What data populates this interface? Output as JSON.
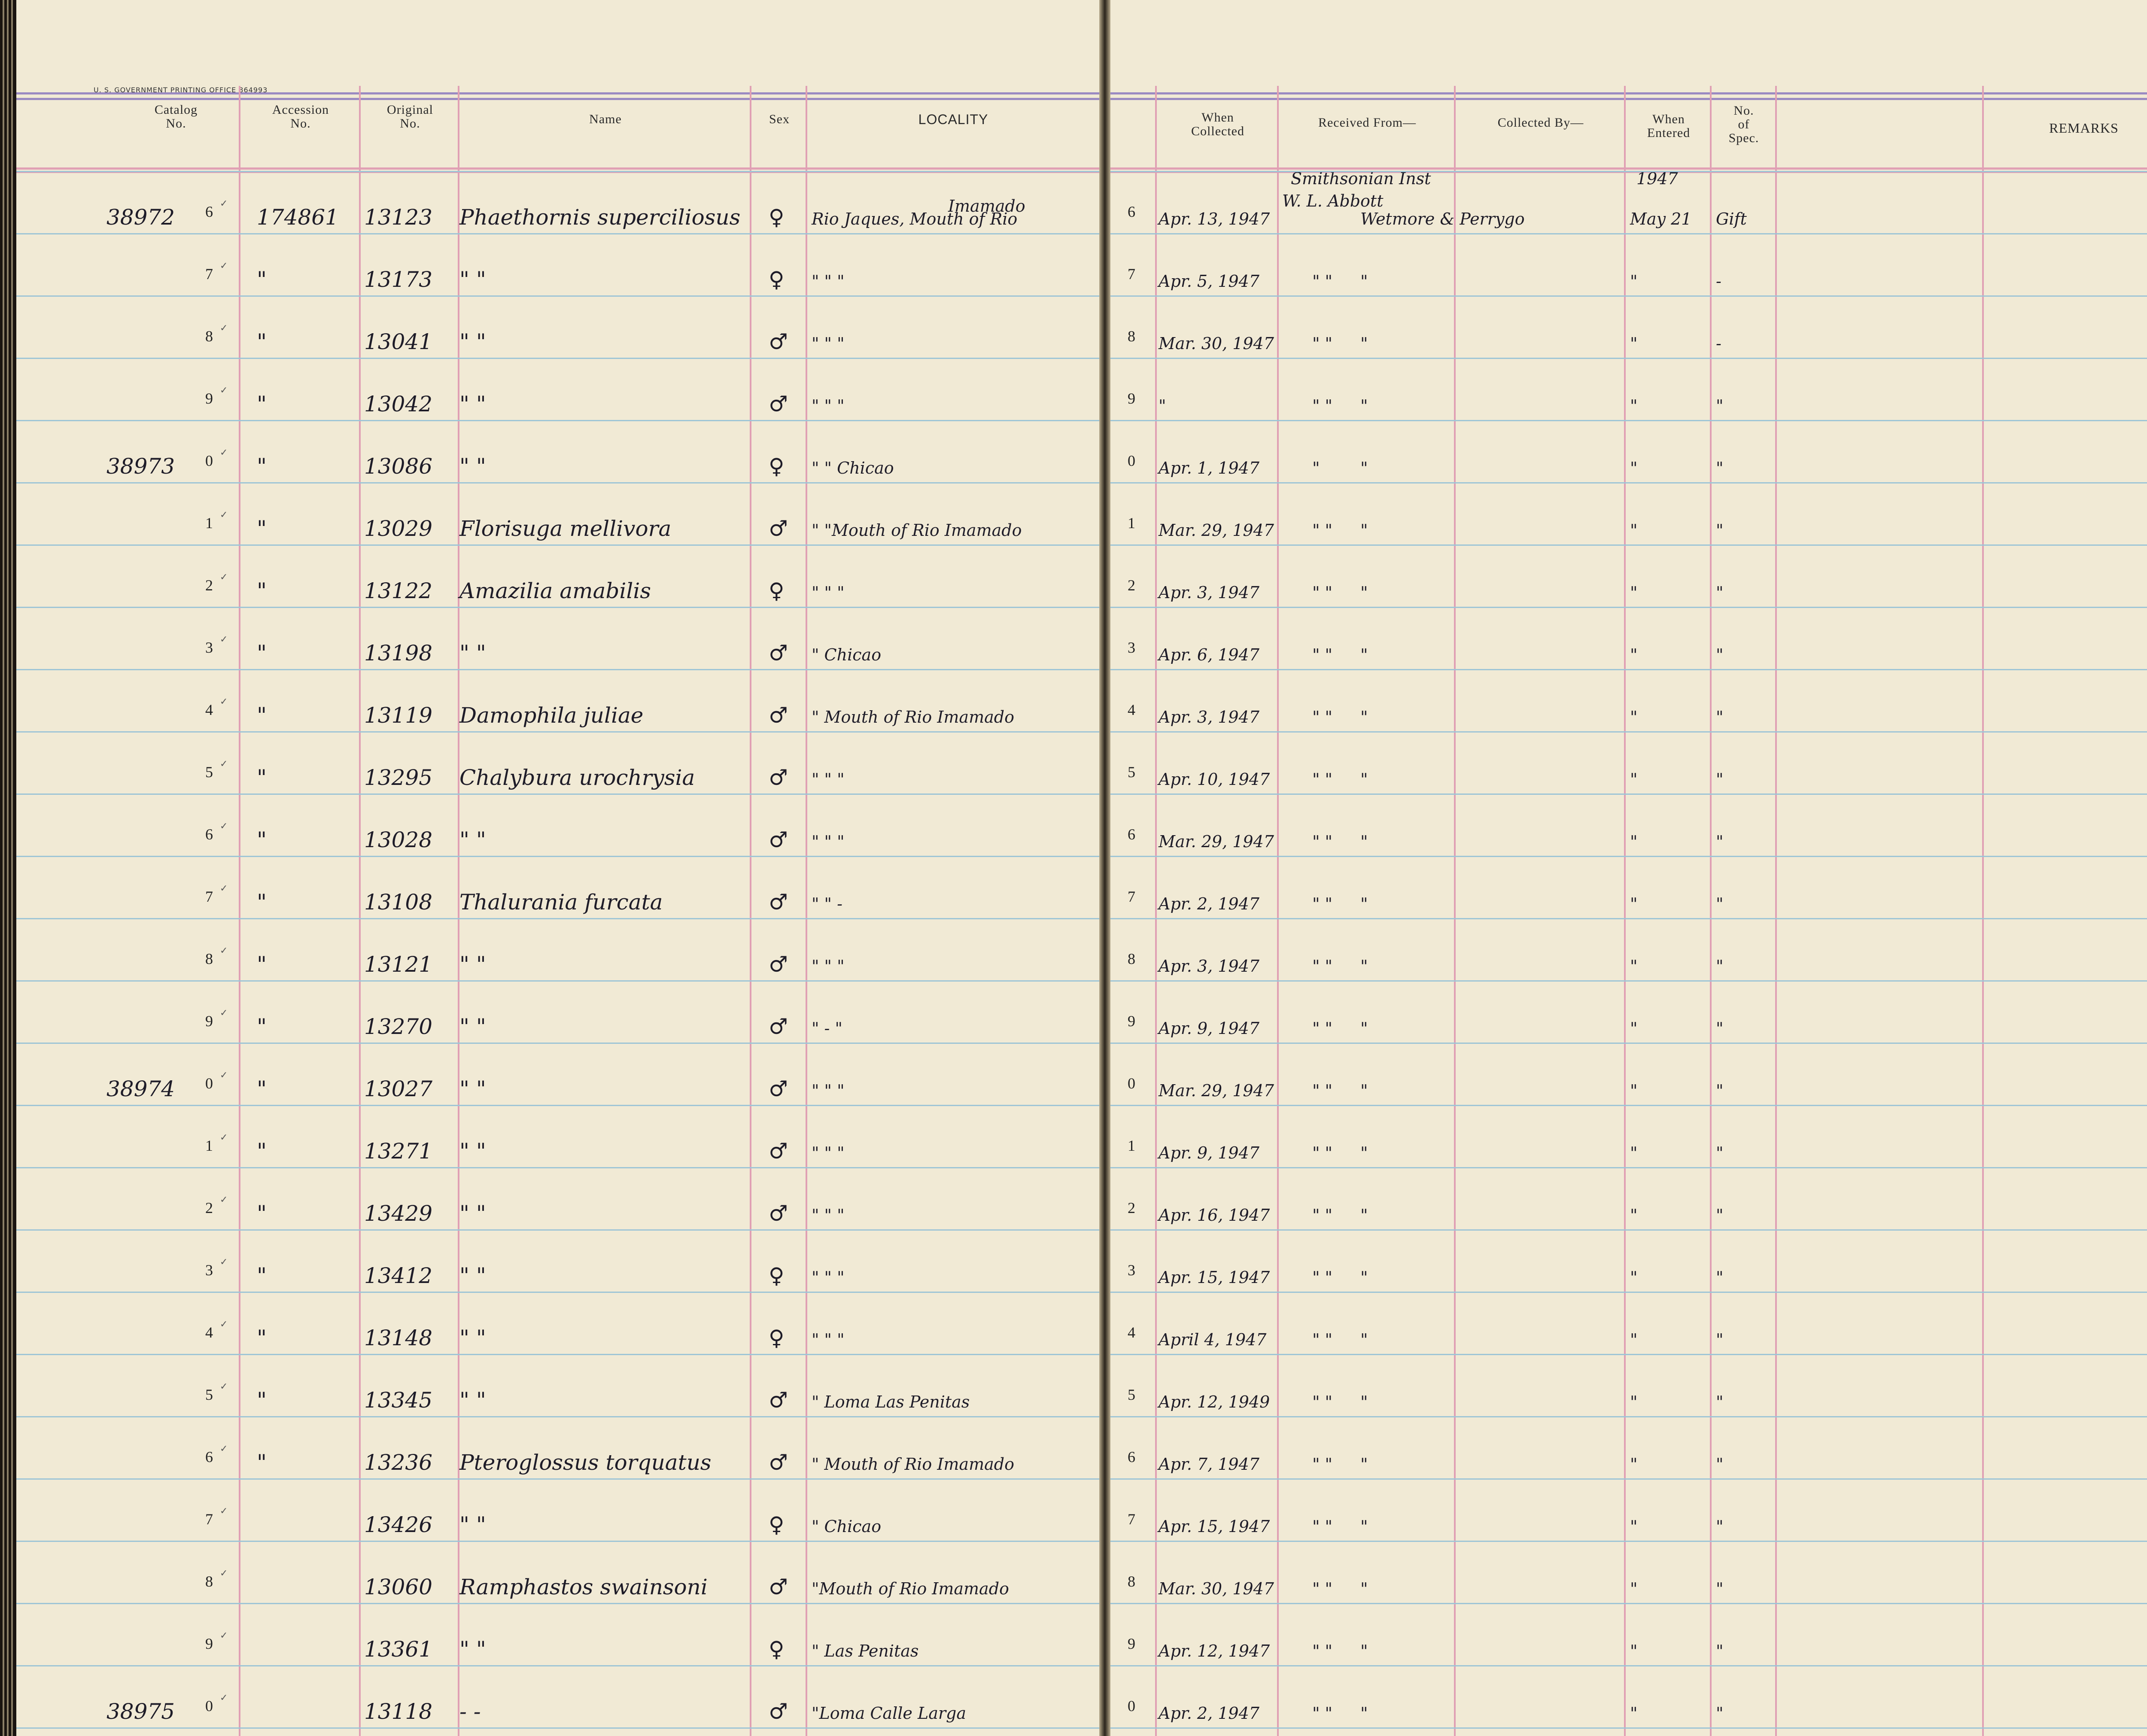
{
  "printer_note": "U. S. GOVERNMENT PRINTING OFFICE 864993",
  "headers": {
    "catalog": "Catalog\nNo.",
    "accession": "Accession\nNo.",
    "original": "Original\nNo.",
    "name": "Name",
    "sex": "Sex",
    "locality": "LOCALITY",
    "when_collected": "When\nCollected",
    "received_from": "Received From—",
    "collected_by": "Collected By—",
    "when_entered": "When\nEntered",
    "no_spec": "No.\nof\nSpec.",
    "remarks": "REMARKS"
  },
  "top_notes": {
    "locality_above": "Imamado",
    "received_line1": "Smithsonian Inst",
    "received_line2": "W. L. Abbott",
    "entered_year": "1947"
  },
  "rows": [
    {
      "cat_prefix": "38972",
      "cat_digit": "6",
      "tick": "✓",
      "acc": "174861",
      "orig": "13123",
      "name": "Phaethornis superciliosus",
      "sex": "♀",
      "loc": "Rio Jaques, Mouth of Rio",
      "rownum": "6",
      "when": "Apr. 13, 1947",
      "recv": "",
      "coll": "Wetmore & Perrygo",
      "entered": "May 21",
      "spec": "Gift"
    },
    {
      "cat_prefix": "",
      "cat_digit": "7",
      "tick": "✓",
      "acc": "\"",
      "orig": "13173",
      "name": "\"        \"",
      "sex": "♀",
      "loc": "\"   \"        \"",
      "rownum": "7",
      "when": "Apr. 5, 1947",
      "recv": "\"     \"",
      "coll": "\"",
      "entered": "\"",
      "spec": "-"
    },
    {
      "cat_prefix": "",
      "cat_digit": "8",
      "tick": "✓",
      "acc": "\"",
      "orig": "13041",
      "name": "\"        \"",
      "sex": "♂",
      "loc": "\"    \"      \"",
      "rownum": "8",
      "when": "Mar. 30, 1947",
      "recv": "\"     \"",
      "coll": "\"",
      "entered": "\"",
      "spec": "-"
    },
    {
      "cat_prefix": "",
      "cat_digit": "9",
      "tick": "✓",
      "acc": "\"",
      "orig": "13042",
      "name": "\"        \"",
      "sex": "♂",
      "loc": "\"   \"      \"",
      "rownum": "9",
      "when": "\"",
      "recv": "\"     \"",
      "coll": "\"",
      "entered": "\"",
      "spec": "\""
    },
    {
      "cat_prefix": "38973",
      "cat_digit": "0",
      "tick": "✓",
      "acc": "\"",
      "orig": "13086",
      "name": "\"        \"",
      "sex": "♀",
      "loc": "\"    \"  Chicao",
      "rownum": "0",
      "when": "Apr. 1, 1947",
      "recv": "\"",
      "coll": "\"",
      "entered": "\"",
      "spec": "\""
    },
    {
      "cat_prefix": "",
      "cat_digit": "1",
      "tick": "✓",
      "acc": "\"",
      "orig": "13029",
      "name": "Florisuga mellivora",
      "sex": "♂",
      "loc": "\"  \"Mouth of Rio Imamado",
      "rownum": "1",
      "when": "Mar. 29, 1947",
      "recv": "\"     \"",
      "coll": "\"",
      "entered": "\"",
      "spec": "\""
    },
    {
      "cat_prefix": "",
      "cat_digit": "2",
      "tick": "✓",
      "acc": "\"",
      "orig": "13122",
      "name": "Amazilia amabilis",
      "sex": "♀",
      "loc": "\"    \"      \"",
      "rownum": "2",
      "when": "Apr. 3, 1947",
      "recv": "\"     \"",
      "coll": "\"",
      "entered": "\"",
      "spec": "\""
    },
    {
      "cat_prefix": "",
      "cat_digit": "3",
      "tick": "✓",
      "acc": "\"",
      "orig": "13198",
      "name": "\"        \"",
      "sex": "♂",
      "loc": "\"   Chicao",
      "rownum": "3",
      "when": "Apr. 6, 1947",
      "recv": "\"     \"",
      "coll": "\"",
      "entered": "\"",
      "spec": "\""
    },
    {
      "cat_prefix": "",
      "cat_digit": "4",
      "tick": "✓",
      "acc": "\"",
      "orig": "13119",
      "name": "Damophila juliae",
      "sex": "♂",
      "loc": "\"  Mouth of Rio Imamado",
      "rownum": "4",
      "when": "Apr. 3, 1947",
      "recv": "\"     \"",
      "coll": "\"",
      "entered": "\"",
      "spec": "\""
    },
    {
      "cat_prefix": "",
      "cat_digit": "5",
      "tick": "✓",
      "acc": "\"",
      "orig": "13295",
      "name": "Chalybura urochrysia",
      "sex": "♂",
      "loc": "\"      \"      \"",
      "rownum": "5",
      "when": "Apr. 10, 1947",
      "recv": "\"     \"",
      "coll": "\"",
      "entered": "\"",
      "spec": "\""
    },
    {
      "cat_prefix": "",
      "cat_digit": "6",
      "tick": "✓",
      "acc": "\"",
      "orig": "13028",
      "name": "\"        \"",
      "sex": "♂",
      "loc": "\"    \"      \"",
      "rownum": "6",
      "when": "Mar. 29, 1947",
      "recv": "\"     \"",
      "coll": "\"",
      "entered": "\"",
      "spec": "\""
    },
    {
      "cat_prefix": "",
      "cat_digit": "7",
      "tick": "✓",
      "acc": "\"",
      "orig": "13108",
      "name": "Thalurania furcata",
      "sex": "♂",
      "loc": "\"    \"    -",
      "rownum": "7",
      "when": "Apr. 2, 1947",
      "recv": "\"     \"",
      "coll": "\"",
      "entered": "\"",
      "spec": "\""
    },
    {
      "cat_prefix": "",
      "cat_digit": "8",
      "tick": "✓",
      "acc": "\"",
      "orig": "13121",
      "name": "\"        \"",
      "sex": "♂",
      "loc": "\"    \"      \"",
      "rownum": "8",
      "when": "Apr. 3, 1947",
      "recv": "\"     \"",
      "coll": "\"",
      "entered": "\"",
      "spec": "\""
    },
    {
      "cat_prefix": "",
      "cat_digit": "9",
      "tick": "✓",
      "acc": "\"",
      "orig": "13270",
      "name": "\"        \"",
      "sex": "♂",
      "loc": "\"    -     \"",
      "rownum": "9",
      "when": "Apr. 9, 1947",
      "recv": "\"     \"",
      "coll": "\"",
      "entered": "\"",
      "spec": "\""
    },
    {
      "cat_prefix": "38974",
      "cat_digit": "0",
      "tick": "✓",
      "acc": "\"",
      "orig": "13027",
      "name": "\"        \"",
      "sex": "♂",
      "loc": "\"    \"      \"",
      "rownum": "0",
      "when": "Mar. 29, 1947",
      "recv": "\"     \"",
      "coll": "\"",
      "entered": "\"",
      "spec": "\""
    },
    {
      "cat_prefix": "",
      "cat_digit": "1",
      "tick": "✓",
      "acc": "\"",
      "orig": "13271",
      "name": "\"        \"",
      "sex": "♂",
      "loc": "\"    \"      \"",
      "rownum": "1",
      "when": "Apr. 9, 1947",
      "recv": "\"     \"",
      "coll": "\"",
      "entered": "\"",
      "spec": "\""
    },
    {
      "cat_prefix": "",
      "cat_digit": "2",
      "tick": "✓",
      "acc": "\"",
      "orig": "13429",
      "name": "\"        \"",
      "sex": "♂",
      "loc": "\"    \"      \"",
      "rownum": "2",
      "when": "Apr. 16, 1947",
      "recv": "\"     \"",
      "coll": "\"",
      "entered": "\"",
      "spec": "\""
    },
    {
      "cat_prefix": "",
      "cat_digit": "3",
      "tick": "✓",
      "acc": "\"",
      "orig": "13412",
      "name": "\"        \"",
      "sex": "♀",
      "loc": "\"    \"      \"",
      "rownum": "3",
      "when": "Apr. 15, 1947",
      "recv": "\"     \"",
      "coll": "\"",
      "entered": "\"",
      "spec": "\""
    },
    {
      "cat_prefix": "",
      "cat_digit": "4",
      "tick": "✓",
      "acc": "\"",
      "orig": "13148",
      "name": "\"        \"",
      "sex": "♀",
      "loc": "\"    \"      \"",
      "rownum": "4",
      "when": "April 4, 1947",
      "recv": "\"     \"",
      "coll": "\"",
      "entered": "\"",
      "spec": "\""
    },
    {
      "cat_prefix": "",
      "cat_digit": "5",
      "tick": "✓",
      "acc": "\"",
      "orig": "13345",
      "name": "\"        \"",
      "sex": "♂",
      "loc": "\" Loma Las Penitas",
      "rownum": "5",
      "when": "Apr. 12, 1949",
      "recv": "\"     \"",
      "coll": "\"",
      "entered": "\"",
      "spec": "\""
    },
    {
      "cat_prefix": "",
      "cat_digit": "6",
      "tick": "✓",
      "acc": "\"",
      "orig": "13236",
      "name": "Pteroglossus torquatus",
      "sex": "♂",
      "loc": "\" Mouth of Rio Imamado",
      "rownum": "6",
      "when": "Apr. 7, 1947",
      "recv": "\"     \"",
      "coll": "\"",
      "entered": "\"",
      "spec": "\""
    },
    {
      "cat_prefix": "",
      "cat_digit": "7",
      "tick": "✓",
      "acc": "",
      "orig": "13426",
      "name": "\"        \"",
      "sex": "♀",
      "loc": "\"  Chicao",
      "rownum": "7",
      "when": "Apr. 15, 1947",
      "recv": "\"     \"",
      "coll": "\"",
      "entered": "\"",
      "spec": "\""
    },
    {
      "cat_prefix": "",
      "cat_digit": "8",
      "tick": "✓",
      "acc": "",
      "orig": "13060",
      "name": "Ramphastos swainsoni",
      "sex": "♂",
      "loc": "\"Mouth of Rio Imamado",
      "rownum": "8",
      "when": "Mar. 30, 1947",
      "recv": "\"     \"",
      "coll": "\"",
      "entered": "\"",
      "spec": "\""
    },
    {
      "cat_prefix": "",
      "cat_digit": "9",
      "tick": "✓",
      "acc": "",
      "orig": "13361",
      "name": "\"        \"",
      "sex": "♀",
      "loc": "\"  Las Penitas",
      "rownum": "9",
      "when": "Apr. 12, 1947",
      "recv": "\"     \"",
      "coll": "\"",
      "entered": "\"",
      "spec": "\""
    },
    {
      "cat_prefix": "38975",
      "cat_digit": "0",
      "tick": "✓",
      "acc": "",
      "orig": "13118",
      "name": "-        -",
      "sex": "♂",
      "loc": "\"Loma Calle Larga",
      "rownum": "0",
      "when": "Apr. 2, 1947",
      "recv": "\"     \"",
      "coll": "\"",
      "entered": "\"",
      "spec": "\""
    }
  ]
}
